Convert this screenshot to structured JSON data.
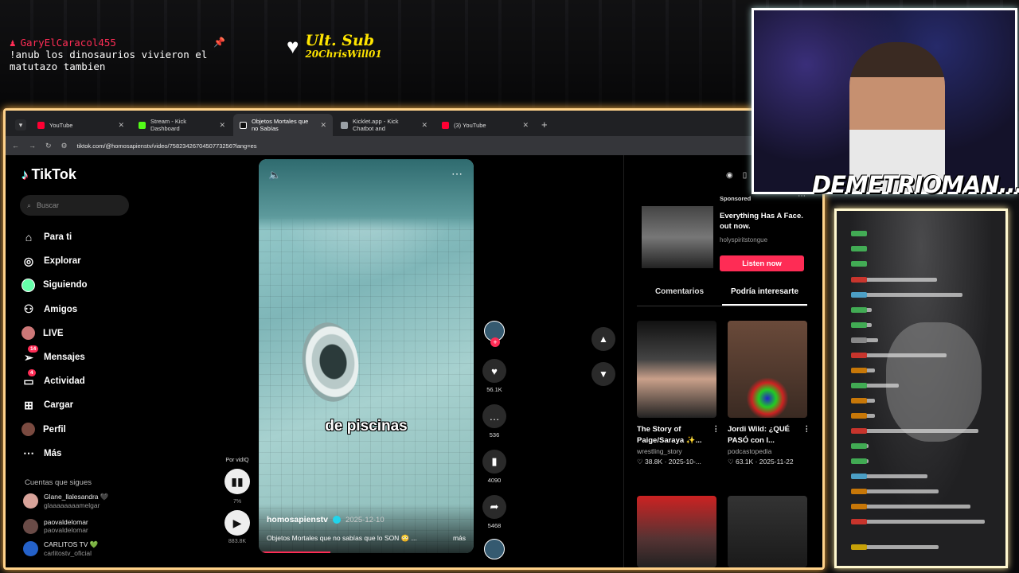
{
  "overlay": {
    "chat_user": "GaryElCaracol455",
    "chat_message_line1": "!anub los dinosaurios vivieron el",
    "chat_message_line2": "matutazo tambien",
    "ult_sub_label": "Ult. Sub",
    "ult_sub_name": "20ChrisWill01",
    "streamer_name": "DEMETRIOMAN..."
  },
  "browser": {
    "tabs": [
      {
        "label": "YouTube",
        "color": "#ff0033"
      },
      {
        "label": "Stream - Kick Dashboard",
        "color": "#53fc18"
      },
      {
        "label": "Objetos Mortales que no Sabías",
        "color": "#ffffff"
      },
      {
        "label": "Kicklet.app - Kick Chatbot and",
        "color": "#9aa0a6"
      },
      {
        "label": "(3) YouTube",
        "color": "#ff0033"
      }
    ],
    "url": "tiktok.com/@homosapienstv/video/7582342670450773256?lang=es"
  },
  "tiktok": {
    "logo": "TikTok",
    "search_placeholder": "Buscar",
    "nav": [
      {
        "label": "Para ti",
        "icon": "home-icon"
      },
      {
        "label": "Explorar",
        "icon": "compass-icon"
      },
      {
        "label": "Siguiendo",
        "icon": "following-icon"
      },
      {
        "label": "Amigos",
        "icon": "friends-icon"
      },
      {
        "label": "LIVE",
        "icon": "live-icon"
      },
      {
        "label": "Mensajes",
        "icon": "messages-icon",
        "badge": "14"
      },
      {
        "label": "Actividad",
        "icon": "activity-icon",
        "badge": "4"
      },
      {
        "label": "Cargar",
        "icon": "upload-icon"
      },
      {
        "label": "Perfil",
        "icon": "profile-icon"
      },
      {
        "label": "Más",
        "icon": "more-icon"
      }
    ],
    "following_title": "Cuentas que sigues",
    "following": [
      {
        "name": "Glane_llalesandra 🖤",
        "handle": "glaaaaaaaamelgar"
      },
      {
        "name": "paovaldelomar",
        "handle": "paovaldelomar"
      },
      {
        "name": "CARLITOS TV 💚",
        "handle": "carlitostv_oficial"
      }
    ],
    "vidiq": {
      "label": "Por vidIQ",
      "percent": "7%",
      "views": "883.8K"
    },
    "video": {
      "caption": "de piscinas",
      "author": "homosapienstv",
      "date": "2025-12-10",
      "description": "Objetos Mortales que no sabías que lo SON 😳 ...",
      "more": "más"
    },
    "actions": {
      "likes": "56.1K",
      "comments": "536",
      "saves": "4090",
      "shares": "5468"
    },
    "ad": {
      "sponsored": "Sponsored",
      "title": "Everything Has A Face. out now.",
      "handle": "holyspiritstongue",
      "button": "Listen now"
    },
    "right_tabs": [
      "Comentarios",
      "Podría interesarte"
    ],
    "cards": [
      {
        "title": "The Story of Paige/Saraya ✨...",
        "author": "wrestling_story",
        "likes": "38.8K",
        "date": "2025-10-..."
      },
      {
        "title": "Jordi Wild: ¿QUÉ PASÓ con l...",
        "author": "podcastopedia",
        "likes": "63.1K",
        "date": "2025-11-22"
      }
    ]
  }
}
